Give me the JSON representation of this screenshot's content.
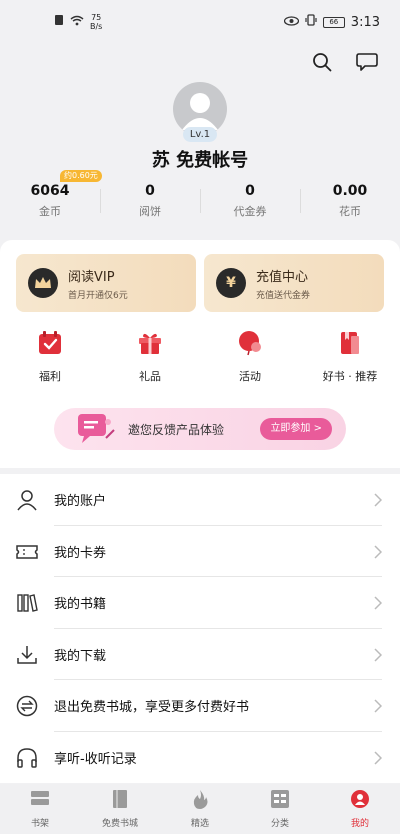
{
  "status_bar": {
    "speed_value": "75",
    "speed_unit": "B/s",
    "battery": "66",
    "time": "3:13"
  },
  "profile": {
    "level": "Lv.1",
    "username": "苏 免费帐号",
    "coin_tag": "约0.60元"
  },
  "stats": [
    {
      "value": "6064",
      "label": "金币"
    },
    {
      "value": "0",
      "label": "阅饼"
    },
    {
      "value": "0",
      "label": "代金券"
    },
    {
      "value": "0.00",
      "label": "花币"
    }
  ],
  "promos": {
    "vip": {
      "title": "阅读VIP",
      "subtitle": "首月开通仅6元",
      "icon": "crown-icon"
    },
    "recharge": {
      "title": "充值中心",
      "subtitle": "充值送代金券",
      "icon": "yen-icon"
    }
  },
  "quick_actions": [
    {
      "label": "福利",
      "icon": "calendar-check-icon"
    },
    {
      "label": "礼品",
      "icon": "gift-icon"
    },
    {
      "label": "活动",
      "icon": "balloon-icon"
    },
    {
      "label": "好书 · 推荐",
      "icon": "book-icon"
    }
  ],
  "banner": {
    "text": "邀您反馈产品体验",
    "button": "立即参加 >"
  },
  "menu": [
    {
      "label": "我的账户",
      "icon": "user-icon"
    },
    {
      "label": "我的卡券",
      "icon": "ticket-icon"
    },
    {
      "label": "我的书籍",
      "icon": "books-icon"
    },
    {
      "label": "我的下载",
      "icon": "download-icon"
    },
    {
      "label": "退出免费书城，享受更多付费好书",
      "icon": "exchange-icon"
    },
    {
      "label": "享听-收听记录",
      "icon": "headphones-icon"
    }
  ],
  "tabs": [
    {
      "label": "书架",
      "icon": "bookshelf-icon"
    },
    {
      "label": "免费书城",
      "icon": "free-book-icon"
    },
    {
      "label": "精选",
      "icon": "flame-icon"
    },
    {
      "label": "分类",
      "icon": "category-icon"
    },
    {
      "label": "我的",
      "icon": "profile-icon"
    }
  ],
  "colors": {
    "accent": "#e0303a",
    "banner_button": "#e95b9a",
    "promo_gold": "#f3dcbc"
  }
}
